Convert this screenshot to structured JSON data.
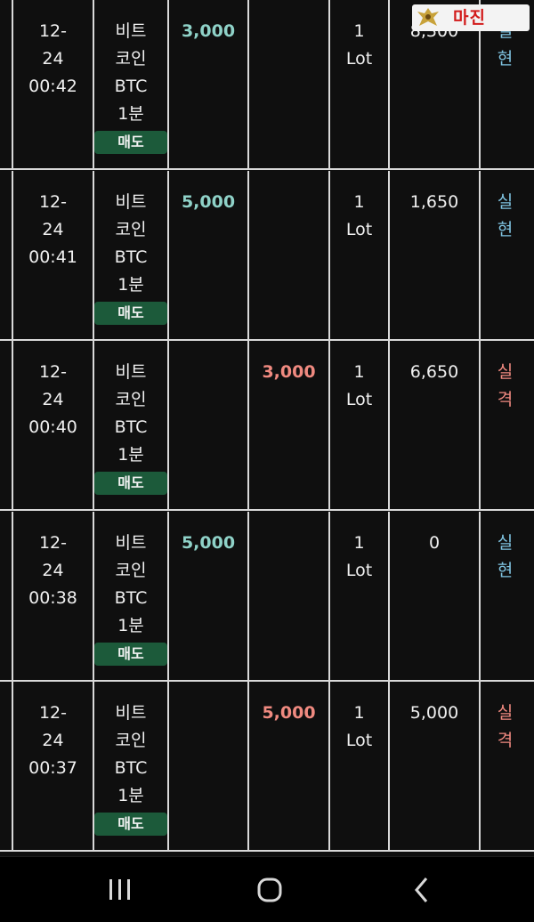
{
  "watermark": {
    "brand": "마진"
  },
  "rows": [
    {
      "date": "12-",
      "day": "24",
      "time": "00:42",
      "name1": "비트",
      "name2": "코인",
      "name3": "BTC",
      "name4": "1분",
      "side": "매도",
      "buy_amount": "3,000",
      "sell_amount": "",
      "qty": "1",
      "unit": "Lot",
      "pnl": "8,300",
      "status1": "실",
      "status2": "현",
      "status_color": "#7fc3e0"
    },
    {
      "date": "12-",
      "day": "24",
      "time": "00:41",
      "name1": "비트",
      "name2": "코인",
      "name3": "BTC",
      "name4": "1분",
      "side": "매도",
      "buy_amount": "5,000",
      "sell_amount": "",
      "qty": "1",
      "unit": "Lot",
      "pnl": "1,650",
      "status1": "실",
      "status2": "현",
      "status_color": "#7fc3e0"
    },
    {
      "date": "12-",
      "day": "24",
      "time": "00:40",
      "name1": "비트",
      "name2": "코인",
      "name3": "BTC",
      "name4": "1분",
      "side": "매도",
      "buy_amount": "",
      "sell_amount": "3,000",
      "qty": "1",
      "unit": "Lot",
      "pnl": "6,650",
      "status1": "실",
      "status2": "격",
      "status_color": "#f08a80"
    },
    {
      "date": "12-",
      "day": "24",
      "time": "00:38",
      "name1": "비트",
      "name2": "코인",
      "name3": "BTC",
      "name4": "1분",
      "side": "매도",
      "buy_amount": "5,000",
      "sell_amount": "",
      "qty": "1",
      "unit": "Lot",
      "pnl": "0",
      "status1": "실",
      "status2": "현",
      "status_color": "#7fc3e0"
    },
    {
      "date": "12-",
      "day": "24",
      "time": "00:37",
      "name1": "비트",
      "name2": "코인",
      "name3": "BTC",
      "name4": "1분",
      "side": "매도",
      "buy_amount": "",
      "sell_amount": "5,000",
      "qty": "1",
      "unit": "Lot",
      "pnl": "5,000",
      "status1": "실",
      "status2": "격",
      "status_color": "#f08a80"
    }
  ],
  "navbar": {
    "recent_icon": "recent-apps-icon",
    "home_icon": "home-icon",
    "back_icon": "back-icon"
  },
  "colors": {
    "buy": "#8fd2c8",
    "sell": "#f08a80",
    "badge": "#1c5a3a",
    "background": "#0f0f0f"
  }
}
